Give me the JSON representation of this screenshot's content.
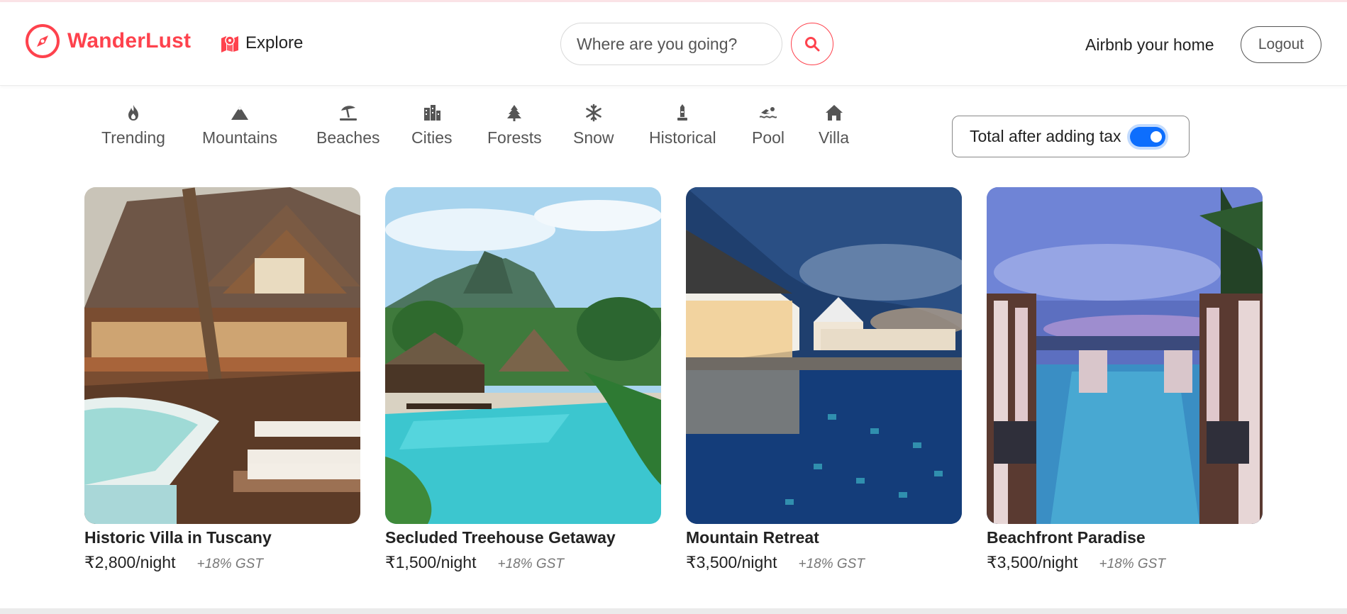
{
  "navbar": {
    "brand_name": "WanderLust",
    "brand_icon": "compass-icon",
    "explore_label": "Explore",
    "explore_icon": "map-location-icon",
    "search_placeholder": "Where are you going?",
    "search_icon": "search-icon",
    "host_link": "Airbnb your home",
    "logout_label": "Logout",
    "accent_color": "#fe424d"
  },
  "filters": [
    {
      "label": "Trending",
      "icon": "fire-icon"
    },
    {
      "label": "Mountains",
      "icon": "mountain-icon"
    },
    {
      "label": "Beaches",
      "icon": "umbrella-beach-icon"
    },
    {
      "label": "Cities",
      "icon": "city-icon"
    },
    {
      "label": "Forests",
      "icon": "tree-icon"
    },
    {
      "label": "Snow",
      "icon": "snowflake-icon"
    },
    {
      "label": "Historical",
      "icon": "monument-icon"
    },
    {
      "label": "Pool",
      "icon": "swimmer-icon"
    },
    {
      "label": "Villa",
      "icon": "house-icon"
    }
  ],
  "tax_toggle": {
    "label": "Total after adding tax",
    "enabled": true,
    "switch_color": "#0d6efd"
  },
  "listings": [
    {
      "title": "Historic Villa in Tuscany",
      "price": "₹2,800/night",
      "tax": "+18% GST"
    },
    {
      "title": "Secluded Treehouse Getaway",
      "price": "₹1,500/night",
      "tax": "+18% GST"
    },
    {
      "title": "Mountain Retreat",
      "price": "₹3,500/night",
      "tax": "+18% GST"
    },
    {
      "title": "Beachfront Paradise",
      "price": "₹3,500/night",
      "tax": "+18% GST"
    }
  ]
}
